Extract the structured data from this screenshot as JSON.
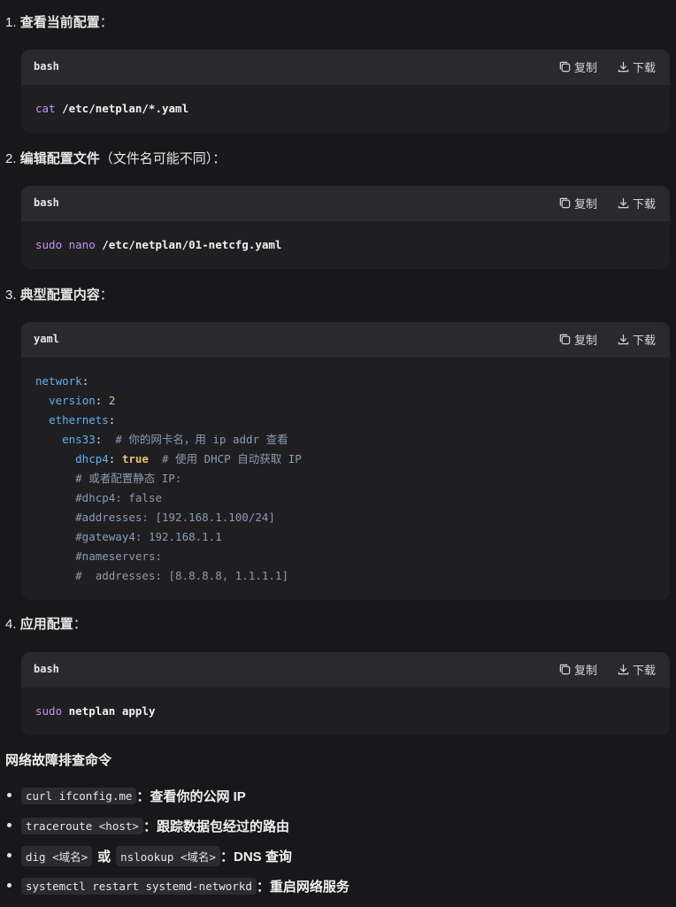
{
  "steps": [
    {
      "num": "1.",
      "title": "查看当前配置",
      "suffix": "：",
      "note": ""
    },
    {
      "num": "2.",
      "title": "编辑配置文件",
      "suffix": "：",
      "note": "（文件名可能不同）"
    },
    {
      "num": "3.",
      "title": "典型配置内容",
      "suffix": "：",
      "note": ""
    },
    {
      "num": "4.",
      "title": "应用配置",
      "suffix": "：",
      "note": ""
    }
  ],
  "actions": {
    "copy": "复制",
    "download": "下载"
  },
  "blocks": [
    {
      "lang": "bash",
      "cmd": "cat",
      "arg": " /etc/netplan/*.yaml"
    },
    {
      "lang": "bash",
      "cmd": "sudo nano",
      "arg": " /etc/netplan/01-netcfg.yaml"
    },
    {
      "lang": "yaml"
    },
    {
      "lang": "bash",
      "cmd": "sudo",
      "arg": " netplan apply"
    }
  ],
  "yaml": {
    "l1_key": "network",
    "colon": ":",
    "l2_key": "version",
    "l2_val": "2",
    "l3_key": "ethernets",
    "l4_key": "ens33",
    "l4_cm": "# 你的网卡名，用 ip addr 查看",
    "l5_key": "dhcp4",
    "l5_val": "true",
    "l5_cm": "# 使用 DHCP 自动获取 IP",
    "l6": "# 或者配置静态 IP:",
    "l7": "#dhcp4: false",
    "l8": "#addresses: [192.168.1.100/24]",
    "l9": "#gateway4: 192.168.1.1",
    "l10": "#nameservers:",
    "l11": "#  addresses: [8.8.8.8, 1.1.1.1]"
  },
  "troubleshoot": {
    "heading": "网络故障排查命令",
    "items": [
      {
        "code": "curl ifconfig.me",
        "sep": "：",
        "desc": "查看你的公网 IP"
      },
      {
        "code": "traceroute <host>",
        "sep": "：",
        "desc": "跟踪数据包经过的路由"
      },
      {
        "code": "dig <域名>",
        "mid": "或",
        "code2": "nslookup <域名>",
        "sep": "：",
        "desc": "DNS 查询"
      },
      {
        "code": "systemctl restart systemd-networkd",
        "sep": "：",
        "desc": "重启网络服务"
      }
    ]
  }
}
